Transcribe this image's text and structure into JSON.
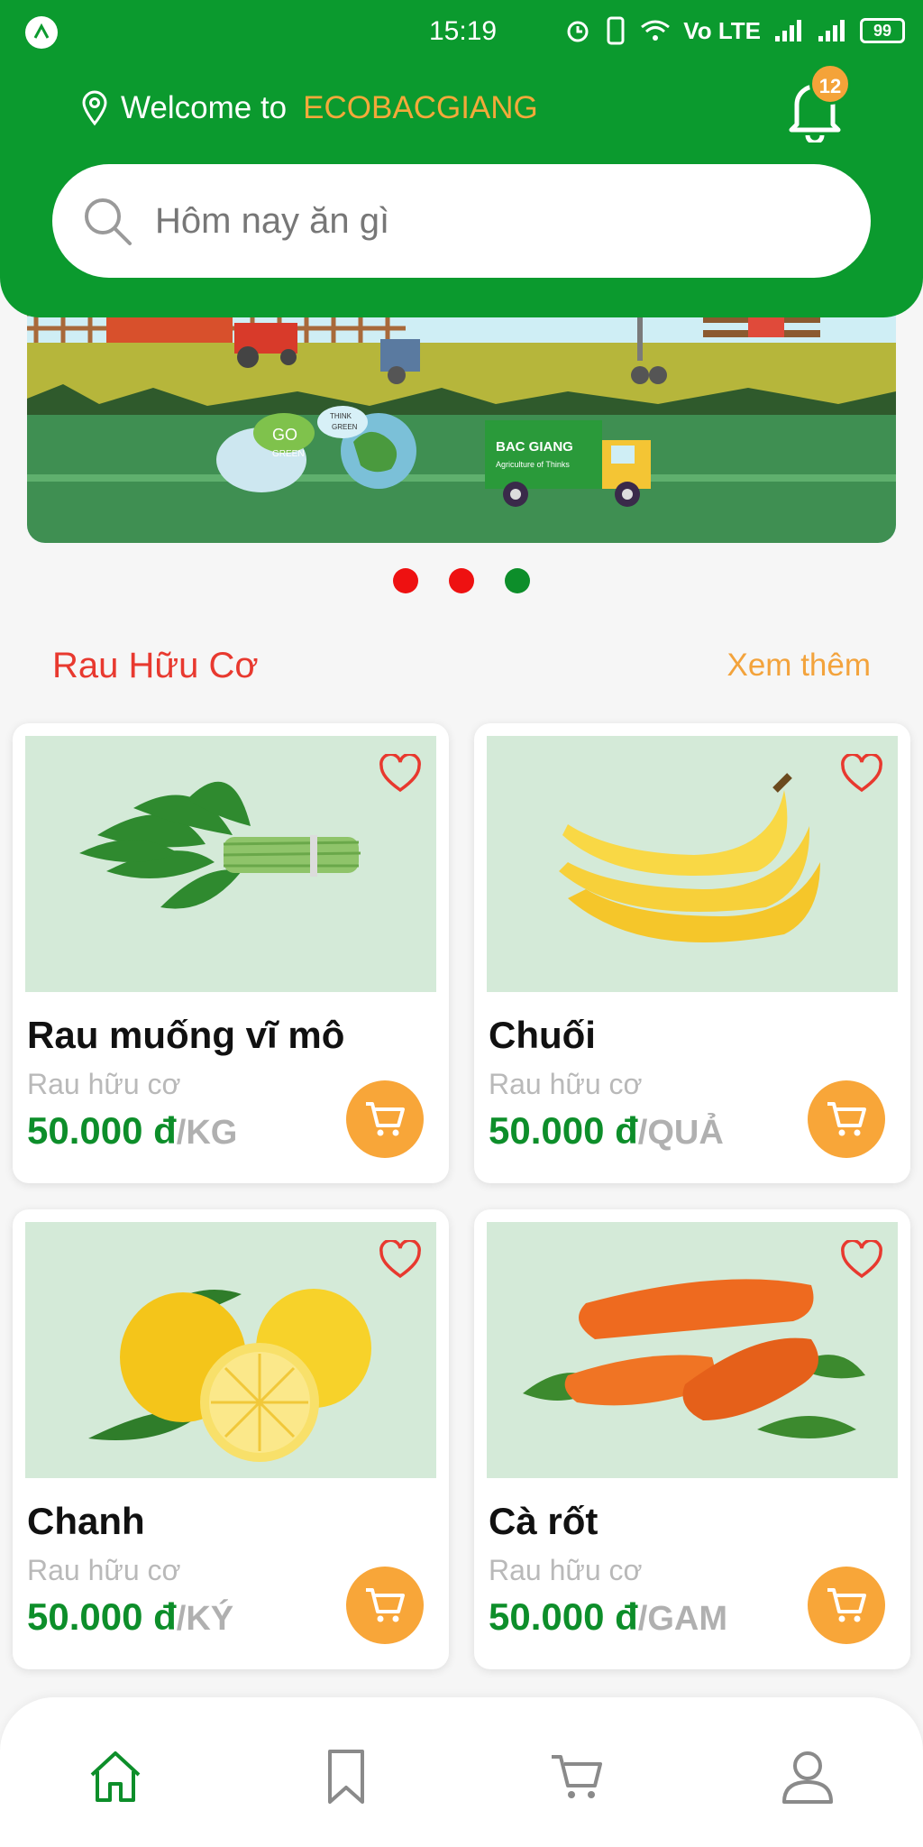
{
  "status_bar": {
    "time": "15:19",
    "network": "Vo LTE",
    "battery": "99"
  },
  "header": {
    "welcome_text": "Welcome to",
    "brand": "ECOBACGIANG",
    "notification_count": "12"
  },
  "search": {
    "placeholder": "Hôm nay ăn gì"
  },
  "banner": {
    "truck_title": "BAC GIANG",
    "truck_subtitle": "Agriculture of Thinks",
    "sign_go": "GO",
    "sign_green": "GREEN",
    "sign_think": "THINK",
    "sign_green2": "GREEN",
    "dots": [
      {
        "color": "#ee1111",
        "active": false
      },
      {
        "color": "#ee1111",
        "active": false
      },
      {
        "color": "#0d8e2a",
        "active": true
      }
    ]
  },
  "section": {
    "title": "Rau Hữu Cơ",
    "see_more": "Xem thêm"
  },
  "products": [
    {
      "name": "Rau muống vĩ mô",
      "category": "Rau hữu cơ",
      "price": "50.000 đ",
      "unit": "/KG",
      "image": "water-spinach"
    },
    {
      "name": "Chuối",
      "category": "Rau hữu cơ",
      "price": "50.000 đ",
      "unit": "/QUẢ",
      "image": "banana"
    },
    {
      "name": "Chanh",
      "category": "Rau hữu cơ",
      "price": "50.000 đ",
      "unit": "/KÝ",
      "image": "lemon"
    },
    {
      "name": "Cà rốt",
      "category": "Rau hữu cơ",
      "price": "50.000 đ",
      "unit": "/GAM",
      "image": "carrot"
    }
  ],
  "nav": {
    "items": [
      {
        "name": "home",
        "active": true
      },
      {
        "name": "bookmark",
        "active": false
      },
      {
        "name": "cart",
        "active": false
      },
      {
        "name": "profile",
        "active": false
      }
    ]
  },
  "colors": {
    "primary_green": "#0b9a2e",
    "accent_orange": "#f4a339",
    "section_red": "#e8392f"
  }
}
